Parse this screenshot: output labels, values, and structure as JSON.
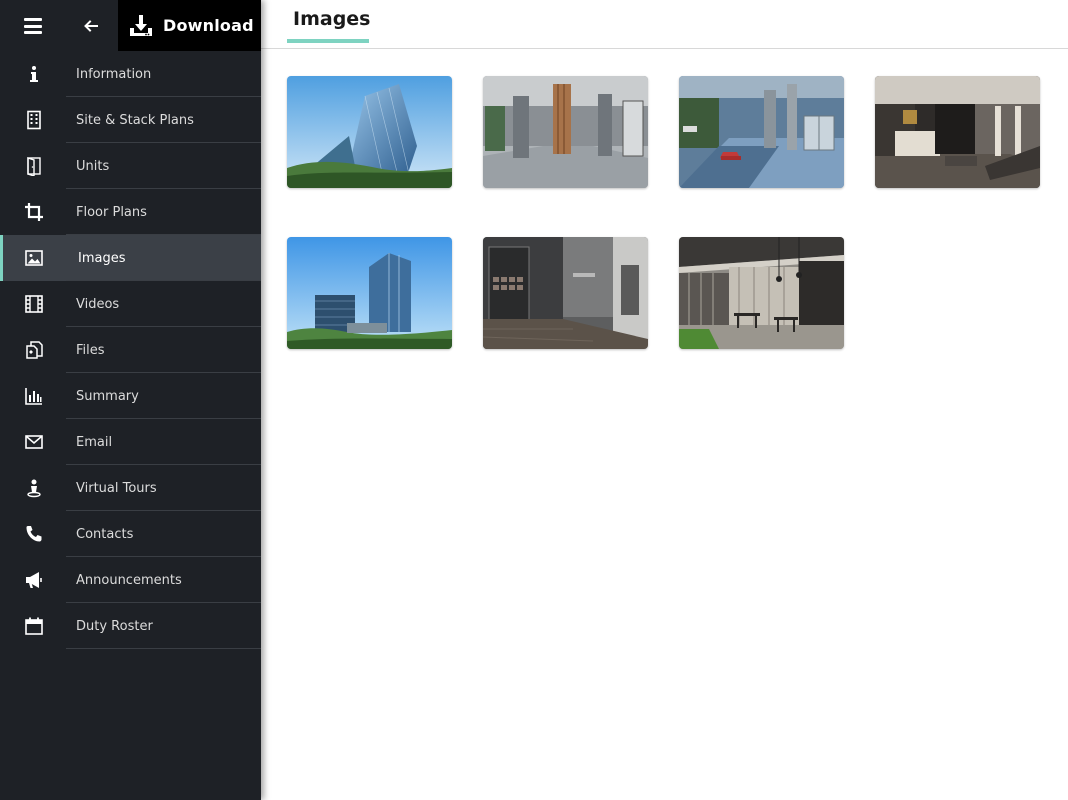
{
  "toolbar": {
    "download_label": "Download",
    "menu_icon": "hamburger-icon",
    "back_icon": "arrow-left-icon",
    "download_icon": "download-icon"
  },
  "sidebar": {
    "items": [
      {
        "label": "Information",
        "icon": "info-icon"
      },
      {
        "label": "Site & Stack Plans",
        "icon": "building-icon"
      },
      {
        "label": "Units",
        "icon": "door-icon"
      },
      {
        "label": "Floor Plans",
        "icon": "crop-icon"
      },
      {
        "label": "Images",
        "icon": "image-icon",
        "active": true
      },
      {
        "label": "Videos",
        "icon": "film-icon"
      },
      {
        "label": "Files",
        "icon": "files-icon"
      },
      {
        "label": "Summary",
        "icon": "bar-chart-icon"
      },
      {
        "label": "Email",
        "icon": "envelope-icon"
      },
      {
        "label": "Virtual Tours",
        "icon": "person-pin-icon"
      },
      {
        "label": "Contacts",
        "icon": "phone-icon"
      },
      {
        "label": "Announcements",
        "icon": "megaphone-icon"
      },
      {
        "label": "Duty Roster",
        "icon": "calendar-icon"
      }
    ]
  },
  "main": {
    "title": "Images",
    "images": [
      {
        "subject": "glass tower exterior"
      },
      {
        "subject": "lobby with wood column"
      },
      {
        "subject": "driveway drop-off"
      },
      {
        "subject": "reception lounge"
      },
      {
        "subject": "twin towers skyline"
      },
      {
        "subject": "lift lobby corridor"
      },
      {
        "subject": "outdoor dining pavilion"
      }
    ]
  },
  "colors": {
    "sidebar_bg": "#1e2126",
    "active_bg": "#3b4047",
    "accent": "#7ed3c1",
    "download_bg": "#000000"
  }
}
